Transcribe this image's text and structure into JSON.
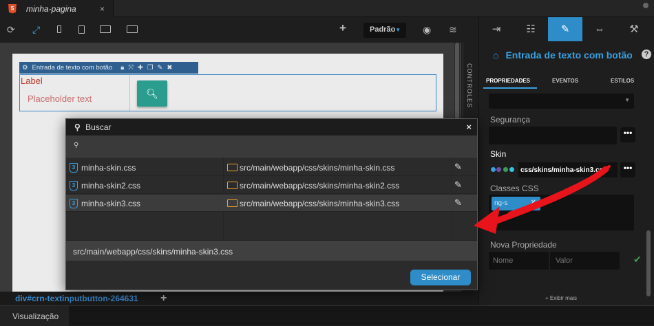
{
  "tab": {
    "name": "minha-pagina",
    "close": "×"
  },
  "toolbar": {
    "preset_label": "Padrão"
  },
  "component": {
    "toolbar_title": "Entrada de texto com botão",
    "label": "Label",
    "placeholder": "Placeholder text"
  },
  "side_strip": {
    "label": "CONTROLES"
  },
  "bottom": {
    "breadcrumb": "div#crn-textinputbutton-264631",
    "add": "+",
    "view_tab": "Visualização"
  },
  "panel": {
    "title": "Entrada de texto com botão",
    "help": "?",
    "subtabs": [
      "PROPRIEDADES",
      "EVENTOS",
      "ESTILOS"
    ],
    "seguranca_label": "Segurança",
    "skin_label": "Skin",
    "skin_value": "css/skins/minha-skin3.css",
    "skin_swatches": [
      "#3aa0e0",
      "#6c4fb0",
      "#3aa050",
      "#3ac0e0"
    ],
    "classes_label": "Classes CSS",
    "class_tag": "ng-s",
    "nova_label": "Nova Propriedade",
    "nome_placeholder": "Nome",
    "valor_placeholder": "Valor",
    "exibir_mais": "+ Exibir mais",
    "more": "•••"
  },
  "dialog": {
    "title": "Buscar",
    "close": "×",
    "search_value": "",
    "files": [
      {
        "name": "minha-skin.css",
        "path": "src/main/webapp/css/skins/minha-skin.css",
        "selected": false
      },
      {
        "name": "minha-skin2.css",
        "path": "src/main/webapp/css/skins/minha-skin2.css",
        "selected": false
      },
      {
        "name": "minha-skin3.css",
        "path": "src/main/webapp/css/skins/minha-skin3.css",
        "selected": true
      }
    ],
    "selected_path": "src/main/webapp/css/skins/minha-skin3.css",
    "select_button": "Selecionar"
  },
  "colors": {
    "accent": "#2e8dc8",
    "annotation_arrow": "#e8141c"
  }
}
